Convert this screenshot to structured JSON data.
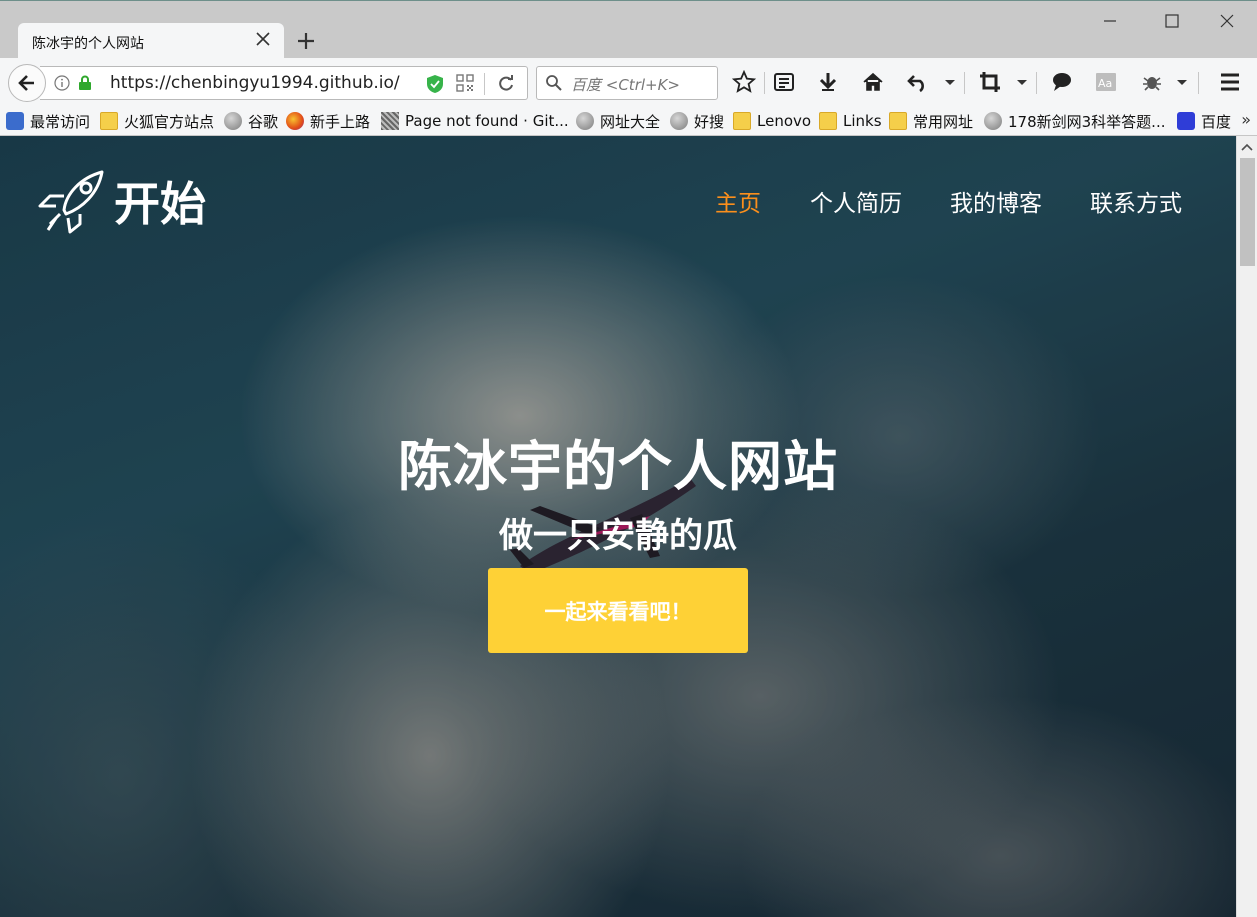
{
  "browser": {
    "tab_title": "陈冰宇的个人网站",
    "url": "https://chenbingyu1994.github.io/i",
    "search_placeholder": "百度 <Ctrl+K>"
  },
  "bookmarks": [
    {
      "label": "最常访问",
      "icon": "magnifier-icon"
    },
    {
      "label": "火狐官方站点",
      "icon": "folder-icon"
    },
    {
      "label": "谷歌",
      "icon": "globe-icon"
    },
    {
      "label": "新手上路",
      "icon": "firefox-icon"
    },
    {
      "label": "Page not found · Git...",
      "icon": "github-icon"
    },
    {
      "label": "网址大全",
      "icon": "globe-icon"
    },
    {
      "label": "好搜",
      "icon": "globe-icon"
    },
    {
      "label": "Lenovo",
      "icon": "folder-icon"
    },
    {
      "label": "Links",
      "icon": "folder-icon"
    },
    {
      "label": "常用网址",
      "icon": "folder-icon"
    },
    {
      "label": "178新剑网3科举答题...",
      "icon": "globe-icon"
    },
    {
      "label": "百度",
      "icon": "baidu-paw-icon"
    }
  ],
  "site": {
    "brand": "开始",
    "nav": [
      "主页",
      "个人简历",
      "我的博客",
      "联系方式"
    ],
    "hero_title": "陈冰宇的个人网站",
    "hero_subtitle": "做一只安静的瓜",
    "hero_button": "一起来看看吧！"
  },
  "colors": {
    "accent_orange": "#fb8f1c",
    "button_yellow": "#fed136"
  }
}
